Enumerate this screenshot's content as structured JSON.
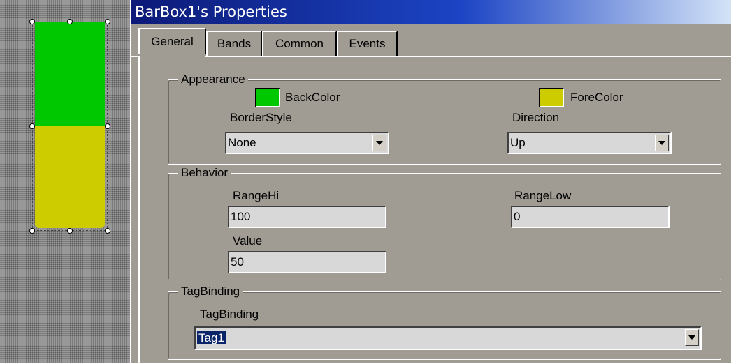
{
  "window": {
    "title": "BarBox1's Properties"
  },
  "preview": {
    "band_colors": {
      "top": "#00c800",
      "bottom": "#cccc00"
    }
  },
  "tabs": [
    {
      "label": "General",
      "active": true
    },
    {
      "label": "Bands",
      "active": false
    },
    {
      "label": "Common",
      "active": false
    },
    {
      "label": "Events",
      "active": false
    }
  ],
  "appearance": {
    "group_label": "Appearance",
    "backcolor_label": "BackColor",
    "backcolor_value": "#00c800",
    "forecolor_label": "ForeColor",
    "forecolor_value": "#cccc00",
    "borderstyle_label": "BorderStyle",
    "borderstyle_value": "None",
    "direction_label": "Direction",
    "direction_value": "Up"
  },
  "behavior": {
    "group_label": "Behavior",
    "rangehi_label": "RangeHi",
    "rangehi_value": "100",
    "rangelow_label": "RangeLow",
    "rangelow_value": "0",
    "value_label": "Value",
    "value_value": "50"
  },
  "tagbinding": {
    "group_label": "TagBinding",
    "field_label": "TagBinding",
    "field_value": "Tag1"
  },
  "icons": {
    "dropdown": "chevron-down-icon"
  }
}
